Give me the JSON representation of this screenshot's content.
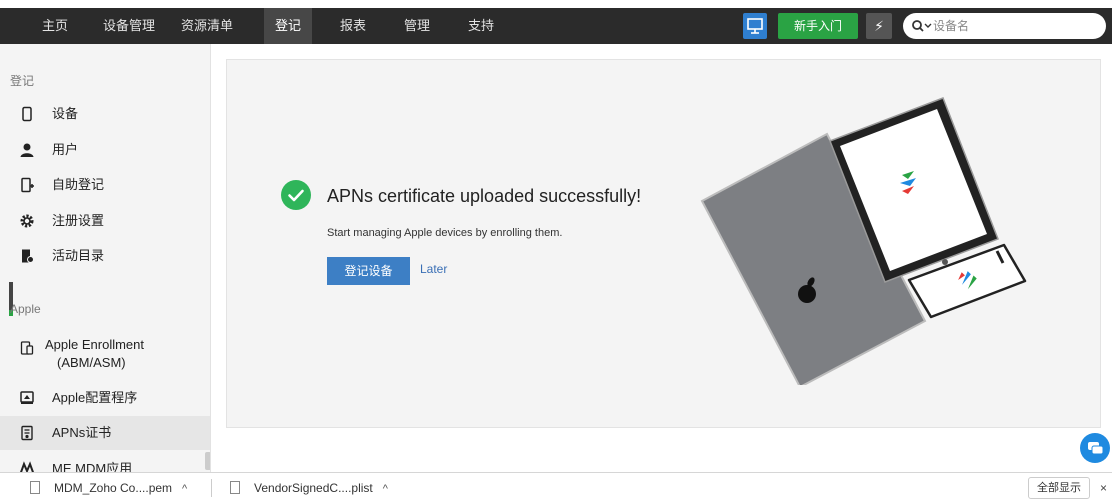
{
  "nav": {
    "items": [
      {
        "label": "主页",
        "active": false
      },
      {
        "label": "设备管理",
        "active": false
      },
      {
        "label": "资源清单",
        "active": false
      },
      {
        "label": "登记",
        "active": true
      },
      {
        "label": "报表",
        "active": false
      },
      {
        "label": "管理",
        "active": false
      },
      {
        "label": "支持",
        "active": false
      }
    ],
    "guide_label": "新手入门",
    "search_placeholder": "设备名"
  },
  "sidebar": {
    "section_enroll": "登记",
    "section_apple": "Apple",
    "items": [
      {
        "label": "设备",
        "icon": "phone-icon"
      },
      {
        "label": "用户",
        "icon": "user-icon"
      },
      {
        "label": "自助登记",
        "icon": "self-enroll-icon"
      },
      {
        "label": "注册设置",
        "icon": "gear-icon"
      },
      {
        "label": "活动目录",
        "icon": "directory-icon"
      }
    ],
    "apple_items": [
      {
        "label_line1": "Apple Enrollment",
        "label_line2": "(ABM/ASM)",
        "icon": "apple-enrollment-icon"
      },
      {
        "label": "Apple配置程序",
        "icon": "configurator-icon"
      },
      {
        "label": "APNs证书",
        "icon": "certificate-icon",
        "selected": true
      },
      {
        "label": "ME MDM应用",
        "icon": "mdm-app-icon"
      }
    ]
  },
  "main": {
    "title": "APNs certificate uploaded successfully!",
    "subtitle": "Start managing Apple devices by enrolling them.",
    "enroll_button": "登记设备",
    "later_link": "Later"
  },
  "downloads": {
    "items": [
      {
        "name": "MDM_Zoho Co....pem"
      },
      {
        "name": "VendorSignedC....plist"
      }
    ],
    "show_all": "全部显示",
    "close": "×"
  },
  "colors": {
    "topbar": "#2b2b2b",
    "active_tab": "#474747",
    "guide_green": "#2aa344",
    "success_green": "#2fb55a",
    "primary_blue": "#3d7fc5"
  }
}
